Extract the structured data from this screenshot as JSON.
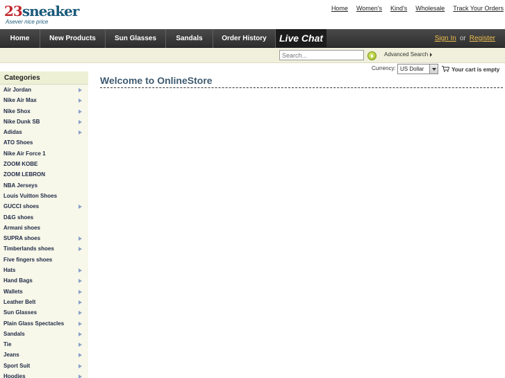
{
  "logo": {
    "brand_number": "23",
    "brand_word": "sneaker",
    "tagline": "Asever nice price"
  },
  "top_links": [
    "Home",
    "Women's",
    "Kind's",
    "Wholesale",
    "Track Your Orders"
  ],
  "nav": {
    "items": [
      "Home",
      "New Products",
      "Sun Glasses",
      "Sandals",
      "Order History"
    ],
    "live_chat": "Live Chat",
    "sign_in": "Sign In",
    "or": "or",
    "register": "Register"
  },
  "search": {
    "placeholder": "Search...",
    "advanced": "Advanced Search"
  },
  "currency": {
    "label": "Currency:",
    "selected": "US Dollar"
  },
  "cart": {
    "text": "Your cart is empty"
  },
  "categories": {
    "title": "Categories",
    "items": [
      {
        "label": "Air Jordan",
        "has_sub": true
      },
      {
        "label": "Nike Air Max",
        "has_sub": true
      },
      {
        "label": "Nike Shox",
        "has_sub": true
      },
      {
        "label": "Nike Dunk SB",
        "has_sub": true
      },
      {
        "label": "Adidas",
        "has_sub": true
      },
      {
        "label": "ATO Shoes",
        "has_sub": false
      },
      {
        "label": "Nike Air Force 1",
        "has_sub": false
      },
      {
        "label": "ZOOM KOBE",
        "has_sub": false
      },
      {
        "label": "ZOOM LEBRON",
        "has_sub": false
      },
      {
        "label": "NBA Jerseys",
        "has_sub": false
      },
      {
        "label": "Louis Vuitton Shoes",
        "has_sub": false
      },
      {
        "label": "GUCCI shoes",
        "has_sub": true
      },
      {
        "label": "D&G shoes",
        "has_sub": false
      },
      {
        "label": "Armani shoes",
        "has_sub": false
      },
      {
        "label": "SUPRA shoes",
        "has_sub": true
      },
      {
        "label": "Timberlands shoes",
        "has_sub": true
      },
      {
        "label": "Five fingers shoes",
        "has_sub": false
      },
      {
        "label": "Hats",
        "has_sub": true
      },
      {
        "label": "Hand Bags",
        "has_sub": true
      },
      {
        "label": "Wallets",
        "has_sub": true
      },
      {
        "label": "Leather Belt",
        "has_sub": true
      },
      {
        "label": "Sun Glasses",
        "has_sub": true
      },
      {
        "label": "Plain Glass Spectacles",
        "has_sub": true
      },
      {
        "label": "Sandals",
        "has_sub": true
      },
      {
        "label": "Tie",
        "has_sub": true
      },
      {
        "label": "Jeans",
        "has_sub": true
      },
      {
        "label": "Sport Suit",
        "has_sub": true
      },
      {
        "label": "Hoodies",
        "has_sub": true
      }
    ]
  },
  "main": {
    "title": "Welcome to OnlineStore"
  },
  "colors": {
    "nav_bg": "#3a3a3a",
    "auth_link": "#f0c050",
    "sidebar_bg": "#f7f7ea",
    "title": "#3e5a70",
    "logo_red": "#c1272d",
    "logo_teal": "#1a5a7a"
  }
}
